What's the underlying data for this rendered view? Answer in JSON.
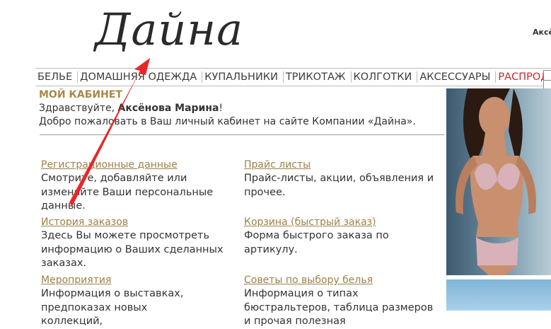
{
  "header": {
    "logo_text": "Дайна",
    "user_name_partial": "Аксё"
  },
  "nav": {
    "items": [
      "БЕЛЬЕ",
      "ДОМАШНЯЯ ОДЕЖДА",
      "КУПАЛЬНИКИ",
      "ТРИКОТАЖ",
      "КОЛГОТКИ",
      "АКСЕССУАРЫ"
    ],
    "sale_label": "РАСПРОДАЖА"
  },
  "cabinet": {
    "title": "МОЙ КАБИНЕТ",
    "greeting_prefix": "Здравствуйте, ",
    "greeting_name": "Аксёнова Марина",
    "greeting_suffix": "!",
    "welcome": "Добро пожаловать в Ваш личный кабинет на сайте Компании «Дайна»."
  },
  "sections": {
    "left": [
      {
        "link": "Регистрационные данные",
        "desc": "Смотрите, добавляйте или изменяйте Ваши персональные данные."
      },
      {
        "link": "История заказов",
        "desc": "Здесь Вы можете просмотреть информацию о Ваших сделанных заказах."
      },
      {
        "link": "Мероприятия",
        "desc": "Информация о выставках, предпоказах новых коллекций,"
      }
    ],
    "right": [
      {
        "link": "Прайс листы",
        "desc": "Прайс-листы, акции, объявления и прочее."
      },
      {
        "link": "Корзина (быстрый заказ)",
        "desc": "Форма быстрого заказа по артикулу."
      },
      {
        "link": "Советы по выбору белья",
        "desc": "Информация о типах бюстральтеров, таблица размеров и прочая полезная"
      }
    ]
  },
  "colors": {
    "accent_gold": "#a8894a",
    "link_gold": "#9e8148",
    "sale_red": "#c4282e",
    "annotation_arrow": "#e8262a"
  },
  "icons": {
    "annotation": "red-arrow-icon"
  }
}
